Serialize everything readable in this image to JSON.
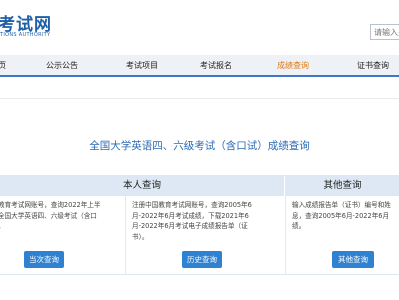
{
  "header": {
    "logo_title": "考试网",
    "logo_subtitle": "TIONS AUTHORITY",
    "search_placeholder": "请输入关"
  },
  "nav": {
    "items": [
      {
        "label": "页"
      },
      {
        "label": "公示公告"
      },
      {
        "label": "考试项目"
      },
      {
        "label": "考试报名"
      },
      {
        "label": "成绩查询"
      },
      {
        "label": "证书查询"
      }
    ]
  },
  "main": {
    "title": "全国大学英语四、六级考试（含口试）成绩查询"
  },
  "sections": {
    "self_query": {
      "heading": "本人查询",
      "left_text_lines": [
        "教育考试网账号，查询2022年上半",
        "全国大学英语四、六级考试（含口",
        "。"
      ],
      "right_text_lines": [
        "注册中国教育考试网账号，查询2005年6",
        "月-2022年6月考试成绩，下载2021年6",
        "月-2022年6月考试电子成绩报告单（证",
        "书）。"
      ],
      "current_button": "当次查询",
      "history_button": "历史查询"
    },
    "other_query": {
      "heading": "其他查询",
      "text_lines": [
        "输入成绩报告单（证书）编号和姓",
        "息，查询2005年6月-2022年6月",
        "绩。"
      ],
      "button": "其他查询"
    }
  },
  "colors": {
    "brand_blue": "#1f5fa6",
    "nav_active": "#e07a12",
    "title_blue": "#2d6bb4",
    "button_blue": "#2f82d1",
    "section_head_bg": "#dde8f4"
  }
}
